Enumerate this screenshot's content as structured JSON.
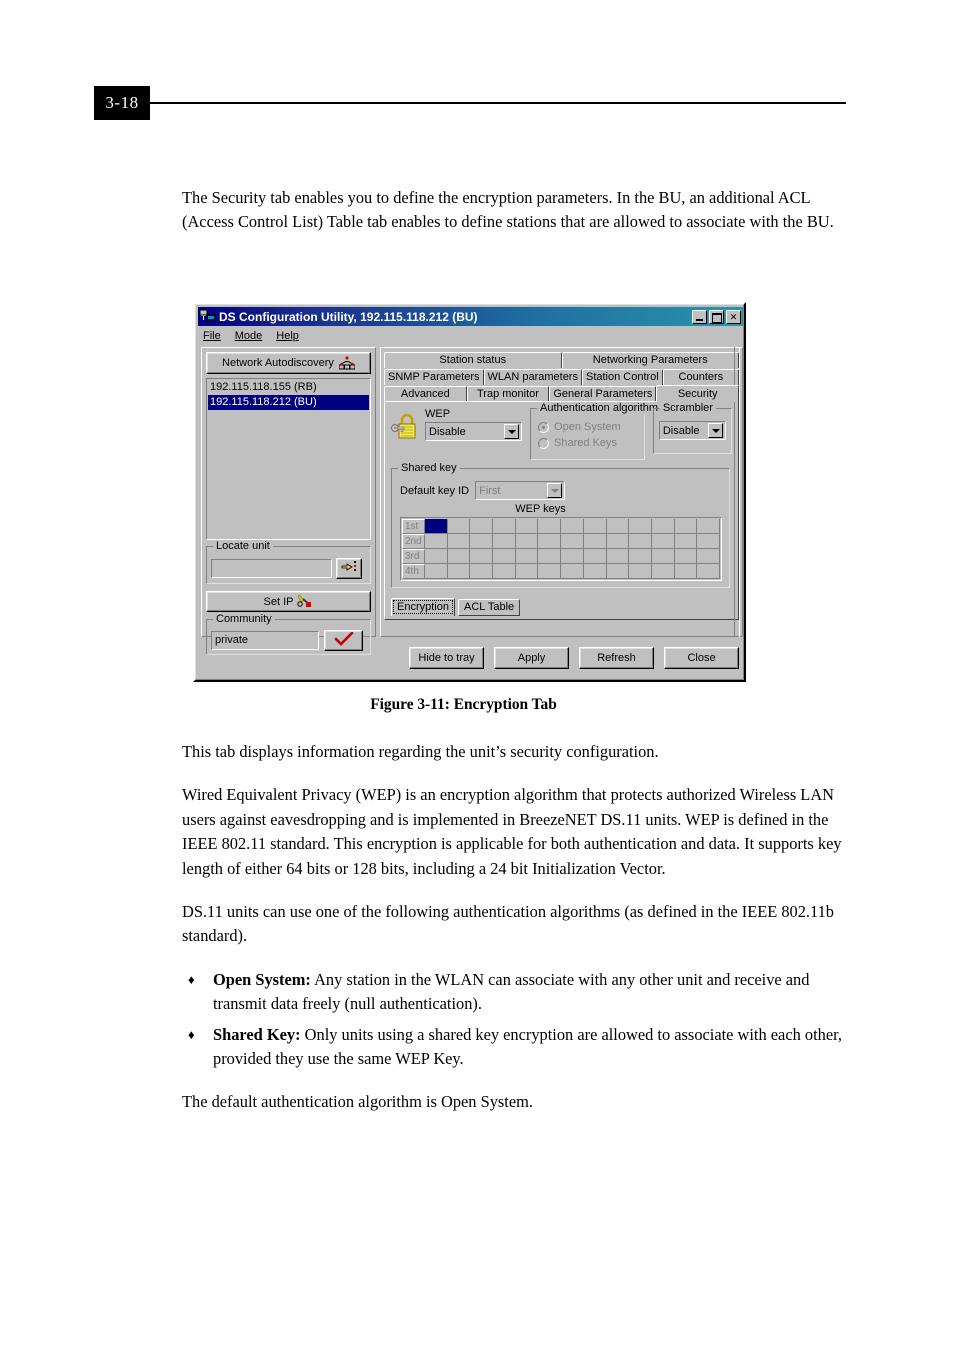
{
  "page": {
    "number": "3-18"
  },
  "intro": {
    "paragraph": "The Security tab enables you to define the encryption parameters. In the BU, an additional ACL (Access Control List) Table tab enables to define stations that are allowed to associate with the BU."
  },
  "figure": {
    "caption": "Figure 3-11: Encryption Tab"
  },
  "dialog": {
    "title": "DS Configuration Utility, 192.115.118.212  (BU)",
    "title_icon": "network-computers-icon",
    "window_buttons": {
      "minimize": "minimize-icon",
      "maximize": "maximize-icon",
      "close": "✕"
    },
    "menu": [
      {
        "label": "File",
        "accel": "F"
      },
      {
        "label": "Mode",
        "accel": "M"
      },
      {
        "label": "Help",
        "accel": "H"
      }
    ],
    "left_pane": {
      "autodiscovery_button": "Network Autodiscovery",
      "autodiscovery_icon": "network-topology-icon",
      "stations": [
        {
          "label": "192.115.118.155  (RB)",
          "selected": false
        },
        {
          "label": "192.115.118.212  (BU)",
          "selected": true
        }
      ],
      "locate_unit": {
        "group_label": "Locate unit",
        "value": "",
        "button_icon": "pointing-hand-icon"
      },
      "set_ip_button": "Set IP",
      "set_ip_icon": "wrench-icon",
      "community": {
        "group_label": "Community",
        "value": "private",
        "button_icon": "red-checkmark-icon"
      }
    },
    "tabs": {
      "row1": [
        {
          "label": "Station status",
          "active": false
        },
        {
          "label": "Networking Parameters",
          "active": false
        }
      ],
      "row2": [
        {
          "label": "SNMP Parameters",
          "active": false
        },
        {
          "label": "WLAN parameters",
          "active": false
        },
        {
          "label": "Station Control",
          "active": false
        },
        {
          "label": "Counters",
          "active": false
        }
      ],
      "row3": [
        {
          "label": "Advanced",
          "active": false
        },
        {
          "label": "Trap monitor",
          "active": false
        },
        {
          "label": "General Parameters",
          "active": false
        },
        {
          "label": "Security",
          "active": true
        }
      ]
    },
    "security_page": {
      "lock_icon": "padlock-key-icon",
      "wep": {
        "label": "WEP",
        "value": "Disable",
        "options": [
          "Disable"
        ]
      },
      "authentication": {
        "group_label": "Authentication algorithm",
        "options": [
          {
            "label": "Open System",
            "checked": true,
            "disabled": true
          },
          {
            "label": "Shared Keys",
            "checked": false,
            "disabled": true
          }
        ]
      },
      "scrambler": {
        "group_label": "Scrambler",
        "value": "Disable",
        "options": [
          "Disable"
        ]
      },
      "shared_key": {
        "group_label": "Shared key",
        "default_key_id_label": "Default key ID",
        "default_key_id_value": "First",
        "wep_keys_caption": "WEP keys",
        "row_headers": [
          "1st",
          "2nd",
          "3rd",
          "4th"
        ],
        "column_count": 13,
        "selected_cell": {
          "row": 0,
          "col": 0
        }
      },
      "sub_tabs": [
        {
          "label": "Encryption",
          "active": true
        },
        {
          "label": "ACL Table",
          "active": false
        }
      ]
    },
    "buttons": [
      {
        "label": "Hide to tray"
      },
      {
        "label": "Apply"
      },
      {
        "label": "Refresh"
      },
      {
        "label": "Close"
      }
    ]
  },
  "body": {
    "p1": "This tab displays information regarding the unit’s security configuration.",
    "p2": "Wired Equivalent Privacy (WEP) is an encryption algorithm that protects authorized Wireless LAN users against eavesdropping and is implemented in BreezeNET DS.11 units. WEP is defined in the IEEE 802.11 standard. This encryption is applicable for both authentication and data.  It supports key length of either 64 bits or 128 bits, including a 24 bit Initialization Vector.",
    "p3": "DS.11 units can use one of the following authentication algorithms (as defined in the IEEE 802.11b standard).",
    "bullets": [
      {
        "mark": "♦",
        "term": "Open System:",
        "text": " Any station in the WLAN can associate with any other unit and receive and transmit data freely (null authentication)."
      },
      {
        "mark": "♦",
        "term": "Shared Key:",
        "text": " Only units using a shared key encryption are allowed to associate with each other, provided they use the same WEP Key."
      }
    ],
    "p4": "The default authentication algorithm is Open System."
  },
  "colors": {
    "titlebar_start": "#00007f",
    "titlebar_end": "#2a94ae",
    "selection": "#000080",
    "face": "#c0c0c0"
  }
}
